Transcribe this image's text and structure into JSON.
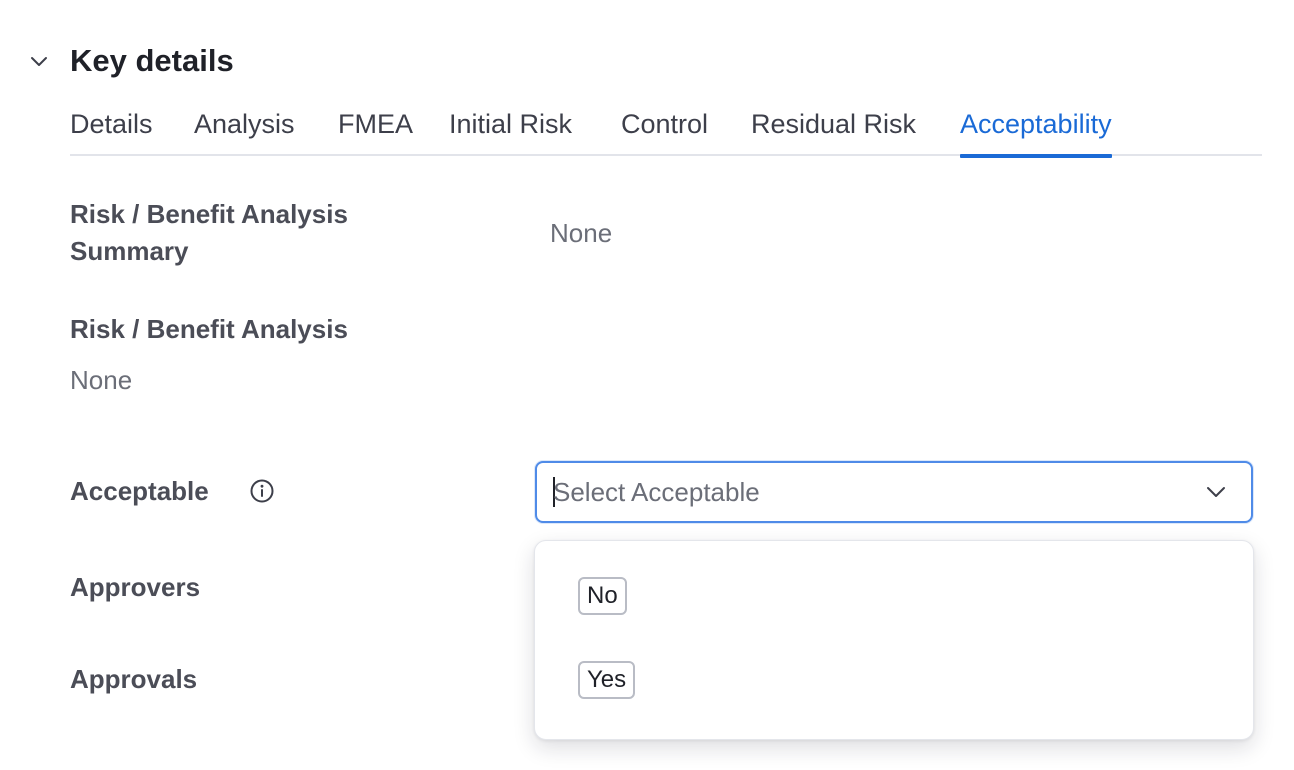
{
  "section": {
    "title": "Key details",
    "toggle_icon": "chevron-down-icon"
  },
  "tabs": [
    {
      "label": "Details",
      "active": false
    },
    {
      "label": "Analysis",
      "active": false
    },
    {
      "label": "FMEA",
      "active": false
    },
    {
      "label": "Initial Risk",
      "active": false
    },
    {
      "label": "Control",
      "active": false
    },
    {
      "label": "Residual Risk",
      "active": false
    },
    {
      "label": "Acceptability",
      "active": true
    }
  ],
  "fields": {
    "summary": {
      "label_line1": "Risk / Benefit Analysis",
      "label_line2": "Summary",
      "value": "None"
    },
    "analysis": {
      "label": "Risk / Benefit Analysis",
      "value": "None"
    },
    "acceptable": {
      "label": "Acceptable",
      "info_icon": "info-icon",
      "placeholder": "Select Acceptable",
      "options": [
        "No",
        "Yes"
      ]
    },
    "approvers": {
      "label": "Approvers"
    },
    "approvals": {
      "label": "Approvals"
    }
  },
  "colors": {
    "accent": "#1a6ad6",
    "focus_border": "#4f8be8",
    "text_primary": "#1f2128",
    "text_label": "#4b4d57",
    "text_muted": "#6b6e78"
  }
}
